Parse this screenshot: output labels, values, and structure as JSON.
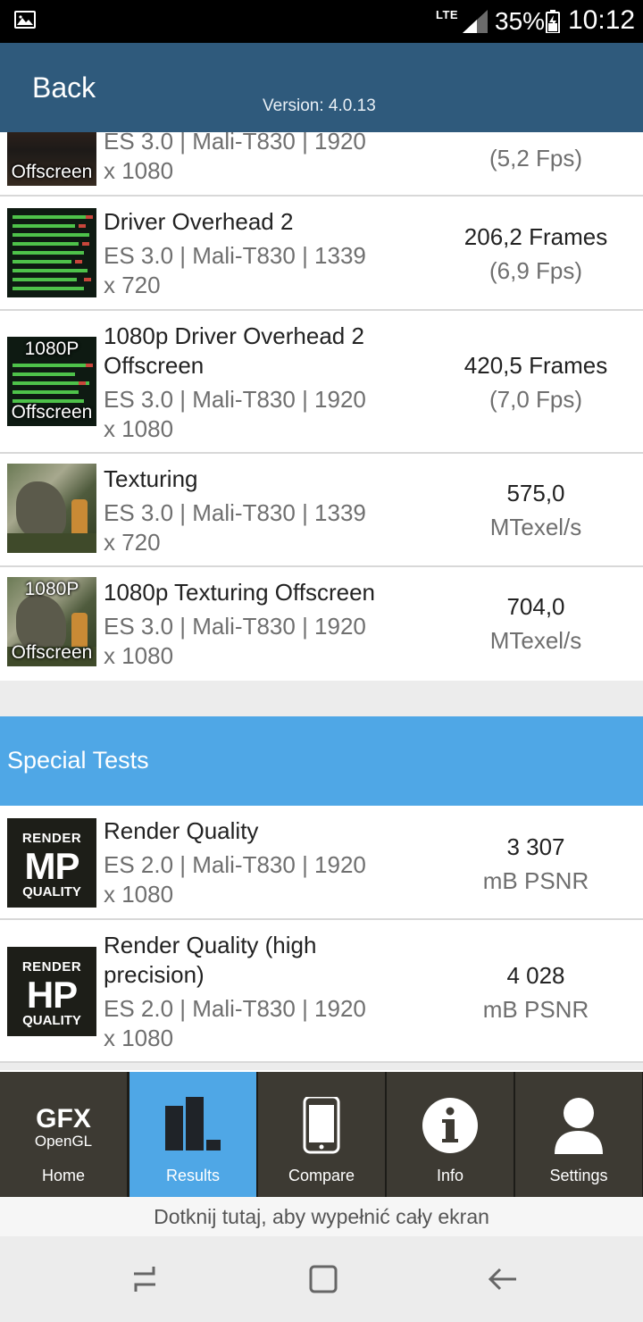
{
  "status_bar": {
    "network": "LTE",
    "battery": "35%",
    "time": "10:12"
  },
  "header": {
    "back_label": "Back",
    "version": "Version: 4.0.13"
  },
  "results": [
    {
      "title": "",
      "subtitle_line1": "ES 3.0 | Mali-T830 | 1920",
      "subtitle_line2": "x 1080",
      "value": "",
      "unit": "(5,2 Fps)",
      "thumb_bottom": "Offscreen"
    },
    {
      "title": "Driver Overhead 2",
      "subtitle_line1": "ES 3.0 | Mali-T830 | 1339",
      "subtitle_line2": "x 720",
      "value": "206,2 Frames",
      "unit": "(6,9 Fps)"
    },
    {
      "title_line1": "1080p Driver Overhead 2",
      "title_line2": "Offscreen",
      "subtitle_line1": "ES 3.0 | Mali-T830 | 1920",
      "subtitle_line2": "x 1080",
      "value": "420,5 Frames",
      "unit": "(7,0 Fps)",
      "thumb_top": "1080P",
      "thumb_bottom": "Offscreen"
    },
    {
      "title": "Texturing",
      "subtitle_line1": "ES 3.0 | Mali-T830 | 1339",
      "subtitle_line2": "x 720",
      "value": "575,0",
      "unit": "MTexel/s"
    },
    {
      "title": "1080p Texturing Offscreen",
      "subtitle_line1": "ES 3.0 | Mali-T830 | 1920",
      "subtitle_line2": "x 1080",
      "value": "704,0",
      "unit": "MTexel/s",
      "thumb_top": "1080P",
      "thumb_bottom": "Offscreen"
    }
  ],
  "special_section": {
    "title": "Special Tests"
  },
  "special_tests": [
    {
      "title": "Render Quality",
      "subtitle_line1": "ES 2.0 | Mali-T830 | 1920",
      "subtitle_line2": "x 1080",
      "value": "3 307",
      "unit": "mB PSNR",
      "thumb_top": "RENDER",
      "thumb_mid": "MP",
      "thumb_bottom": "QUALITY"
    },
    {
      "title_line1": "Render Quality (high",
      "title_line2": "precision)",
      "subtitle_line1": "ES 2.0 | Mali-T830 | 1920",
      "subtitle_line2": "x 1080",
      "value": "4 028",
      "unit": "mB PSNR",
      "thumb_top": "RENDER",
      "thumb_mid": "HP",
      "thumb_bottom": "QUALITY"
    }
  ],
  "tabs": [
    {
      "label": "Home",
      "logo_main": "GFX",
      "logo_sub": "OpenGL",
      "icon": "gfx-logo-icon"
    },
    {
      "label": "Results",
      "icon": "bar-chart-icon",
      "active": true
    },
    {
      "label": "Compare",
      "icon": "phone-icon"
    },
    {
      "label": "Info",
      "icon": "info-icon"
    },
    {
      "label": "Settings",
      "icon": "user-icon"
    }
  ],
  "fullscreen_hint": "Dotknij tutaj, aby wypełnić cały ekran",
  "colors": {
    "header": "#2f5a7c",
    "section_header": "#4fa7e6",
    "tab_active": "#4fa7e6",
    "tab_bg": "#3d3a33"
  }
}
